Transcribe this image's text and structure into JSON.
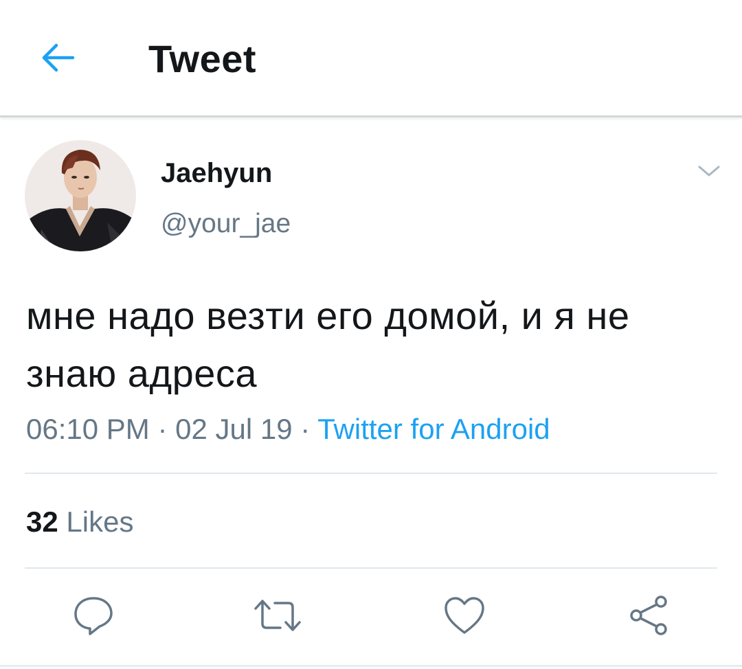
{
  "header": {
    "title": "Tweet",
    "back_icon": "arrow-left-icon"
  },
  "colors": {
    "accent": "#1da1f2",
    "text_primary": "#14171a",
    "text_secondary": "#657786",
    "divider": "#e1e8ed"
  },
  "tweet": {
    "author_name": "Jaehyun",
    "author_handle": "@your_jae",
    "text": "мне надо везти его домой, и я не знаю адреса",
    "time": "06:10 PM",
    "date": "02 Jul 19",
    "separator": "·",
    "source": "Twitter for Android",
    "likes_count": "32",
    "likes_label": "Likes"
  },
  "actions": [
    {
      "name": "reply",
      "icon": "reply-icon"
    },
    {
      "name": "retweet",
      "icon": "retweet-icon"
    },
    {
      "name": "like",
      "icon": "heart-icon"
    },
    {
      "name": "share",
      "icon": "share-icon"
    }
  ]
}
